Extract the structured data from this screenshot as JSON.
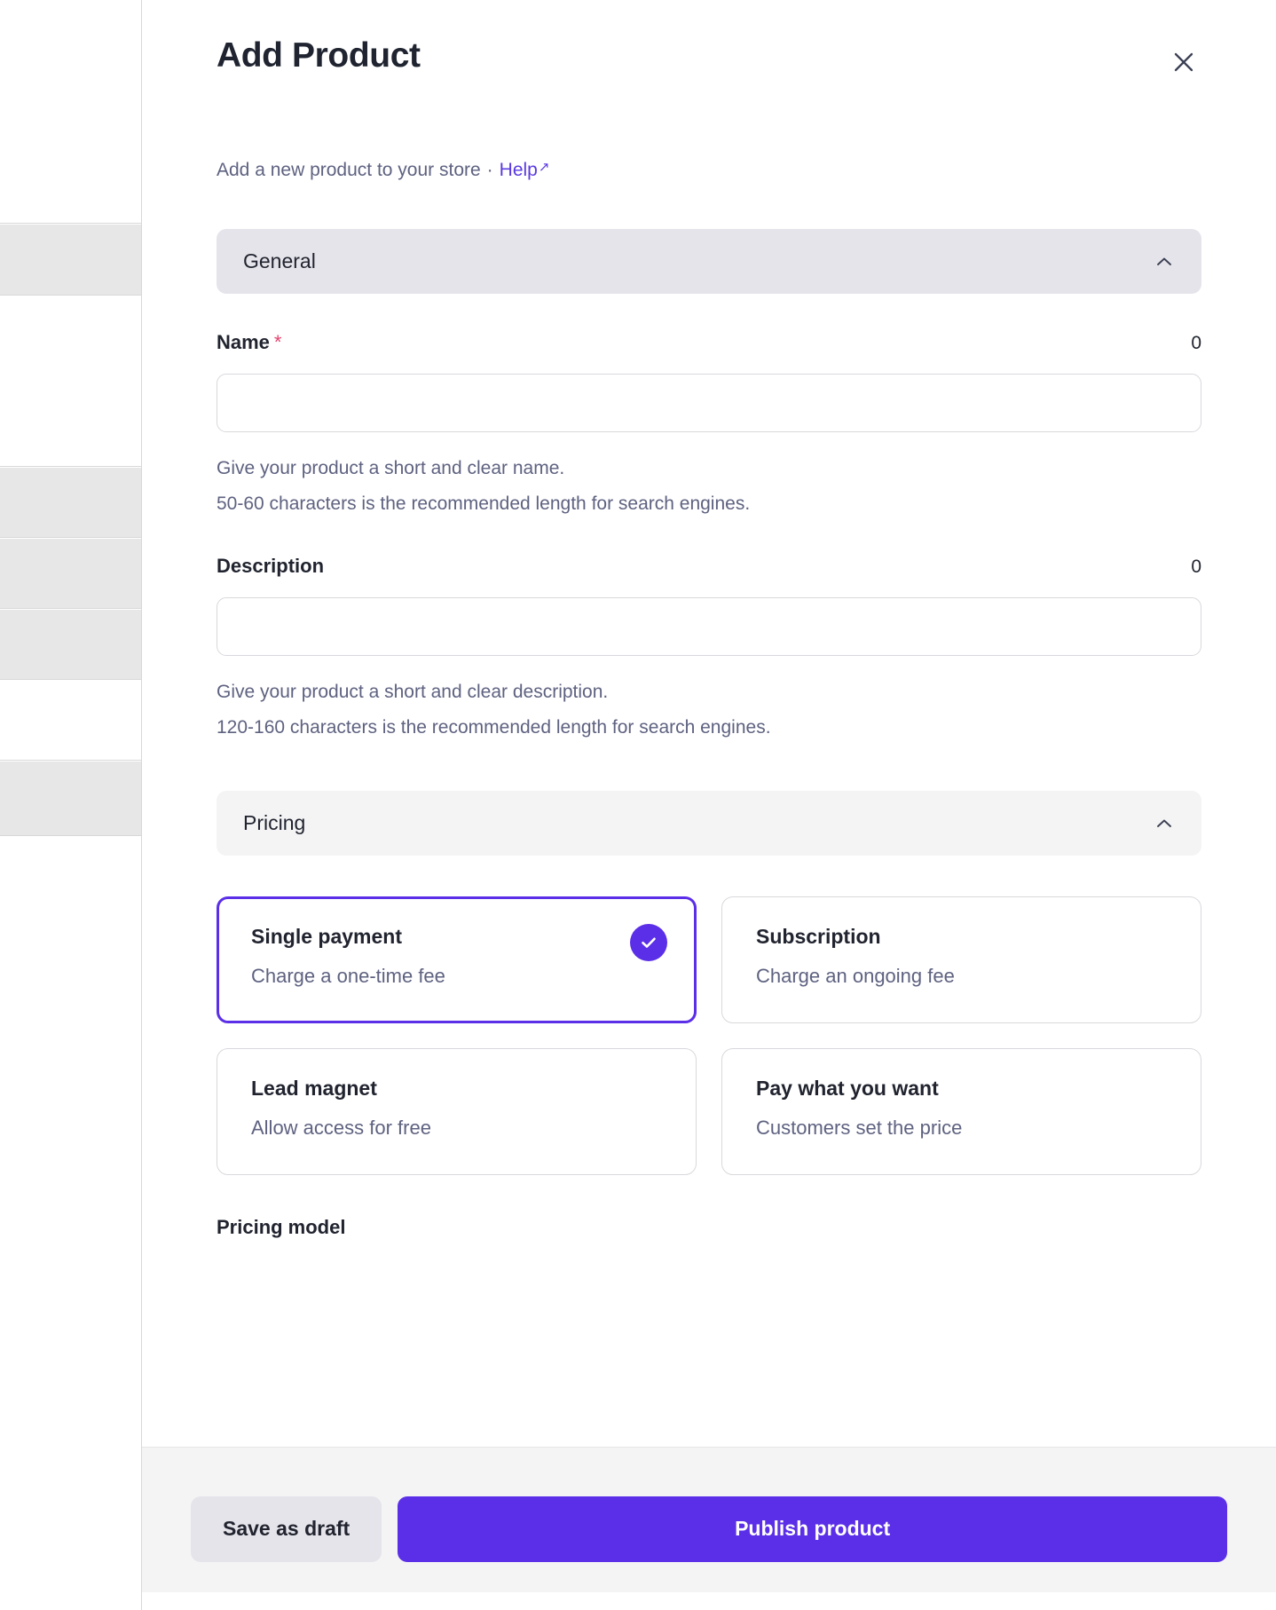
{
  "window": {
    "title": "Add Product",
    "close_icon": "close-icon"
  },
  "subtitle": {
    "text": "Add a new product to your store",
    "separator": "·",
    "help_label": "Help",
    "help_arrow": "↗"
  },
  "sections": {
    "general": {
      "title": "General",
      "collapse_icon": "chevron-up-icon",
      "fields": {
        "name": {
          "label": "Name",
          "required_marker": "*",
          "char_count": "0",
          "value": "",
          "placeholder": "",
          "helper_line_1": "Give your product a short and clear name.",
          "helper_line_2": "50-60 characters is the recommended length for search engines."
        },
        "description": {
          "label": "Description",
          "required_marker": "",
          "char_count": "0",
          "value": "",
          "placeholder": "",
          "helper_line_1": "Give your product a short and clear description.",
          "helper_line_2": "120-160 characters is the recommended length for search engines."
        }
      }
    },
    "pricing": {
      "title": "Pricing",
      "collapse_icon": "chevron-up-icon",
      "options": [
        {
          "title": "Single payment",
          "description": "Charge a one-time fee",
          "selected": true,
          "check_icon": "check-icon"
        },
        {
          "title": "Subscription",
          "description": "Charge an ongoing fee",
          "selected": false
        },
        {
          "title": "Lead magnet",
          "description": "Allow access for free",
          "selected": false
        },
        {
          "title": "Pay what you want",
          "description": "Customers set the price",
          "selected": false
        }
      ],
      "pricing_model_label": "Pricing model"
    }
  },
  "footer": {
    "save_draft_label": "Save as draft",
    "publish_label": "Publish product"
  },
  "colors": {
    "accent": "#5B2FE8",
    "link": "#5B3AE0",
    "required": "#E4426D",
    "section_general_bg": "#E5E4EA",
    "section_pricing_bg": "#F4F4F5",
    "footer_bg": "#F4F4F5",
    "text_primary": "#21242F",
    "text_muted": "#5E6280",
    "border": "#D9D9DE"
  }
}
